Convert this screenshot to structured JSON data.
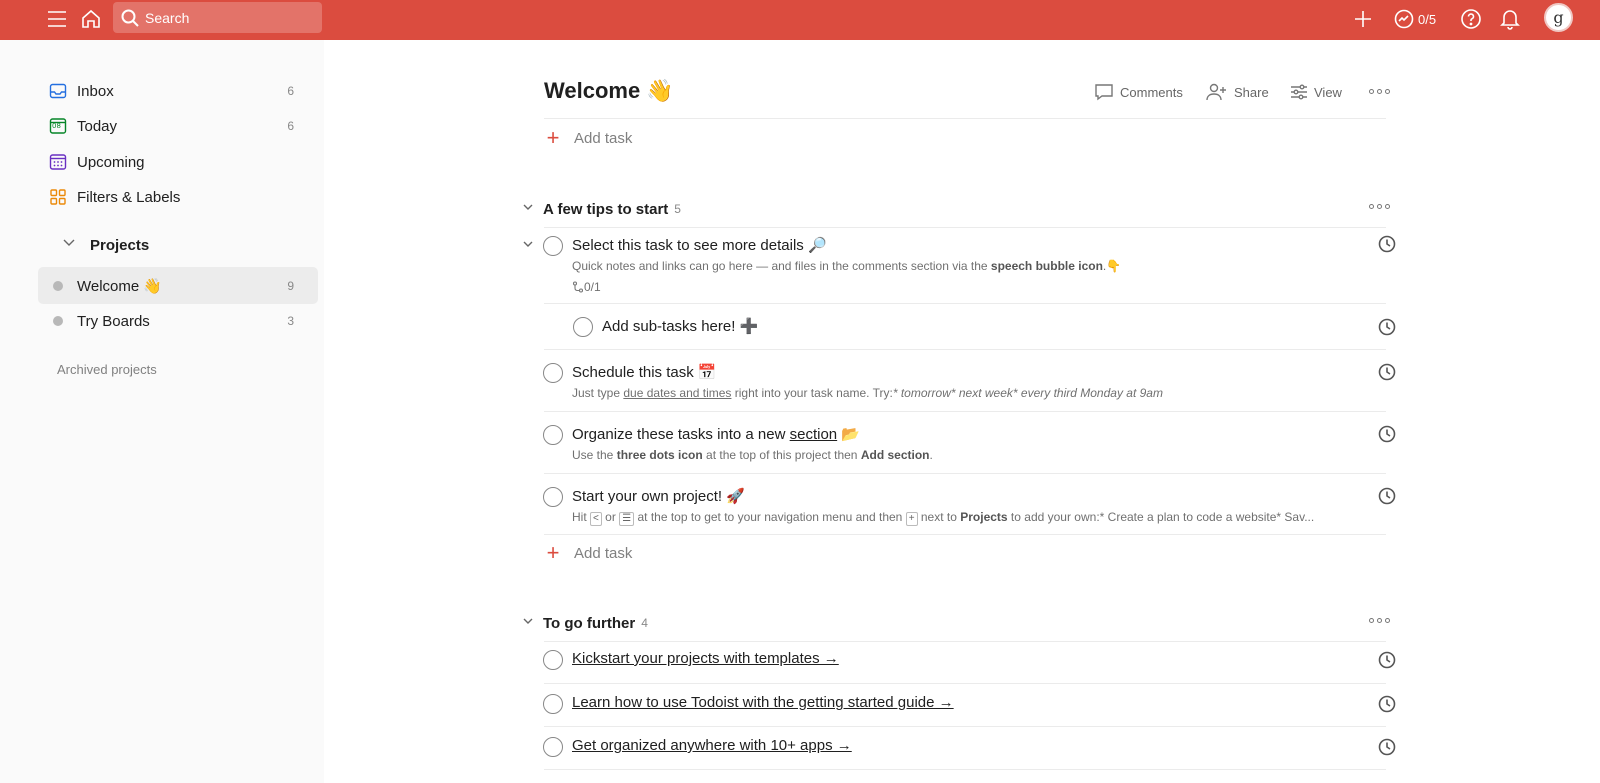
{
  "topbar": {
    "search_placeholder": "Search",
    "karma": "0/5",
    "avatar_letter": "g",
    "color": "#db4c3f"
  },
  "sidebar": {
    "items": [
      {
        "label": "Inbox",
        "count": "6",
        "icon": "inbox-icon"
      },
      {
        "label": "Today",
        "count": "6",
        "icon": "calendar-today-icon",
        "day": "08"
      },
      {
        "label": "Upcoming",
        "count": "",
        "icon": "calendar-upcoming-icon"
      },
      {
        "label": "Filters & Labels",
        "count": "",
        "icon": "filters-icon"
      }
    ],
    "projects_label": "Projects",
    "projects": [
      {
        "label": "Welcome 👋",
        "count": "9"
      },
      {
        "label": "Try Boards",
        "count": "3"
      }
    ],
    "archived_label": "Archived projects"
  },
  "main": {
    "title": "Welcome 👋",
    "actions": {
      "comments": "Comments",
      "share": "Share",
      "view": "View"
    },
    "add_task": "Add task",
    "sections": [
      {
        "title": "A few tips to start",
        "count": "5",
        "tasks": [
          {
            "title": "Select this task to see more details 🔎",
            "desc_pre": "Quick notes and links can go here — and files in the comments section via the ",
            "desc_bold": "speech bubble icon",
            "desc_post": ".👇",
            "subtasks": "0/1"
          },
          {
            "title": "Add sub-tasks here! ➕"
          },
          {
            "title": "Schedule this task 📅",
            "desc_pre": "Just type ",
            "desc_link": "due dates and times",
            "desc_mid": " right into your task name. Try:",
            "desc_italic": "* tomorrow* next week* every third Monday at 9am"
          },
          {
            "title_pre": "Organize these tasks into a new ",
            "title_link": "section",
            "title_post": " 📂",
            "desc_pre": "Use the ",
            "desc_bold1": "three dots icon",
            "desc_mid": " at the top of this project then ",
            "desc_bold2": "Add section",
            "desc_post": "."
          },
          {
            "title": "Start your own project! 🚀",
            "desc_a": "Hit ",
            "key1": "<",
            "desc_b": " or ",
            "key2": "☰",
            "desc_c": " at the top to get to your navigation menu and then ",
            "key3": "+",
            "desc_d": " next to ",
            "desc_bold": "Projects",
            "desc_e": " to add your own:* Create a plan to code a website* Sav..."
          }
        ]
      },
      {
        "title": "To go further",
        "count": "4",
        "tasks": [
          {
            "title": "Kickstart your projects with templates →"
          },
          {
            "title": "Learn how to use Todoist with the getting started guide →"
          },
          {
            "title": "Get organized anywhere with 10+ apps →"
          }
        ]
      }
    ]
  }
}
